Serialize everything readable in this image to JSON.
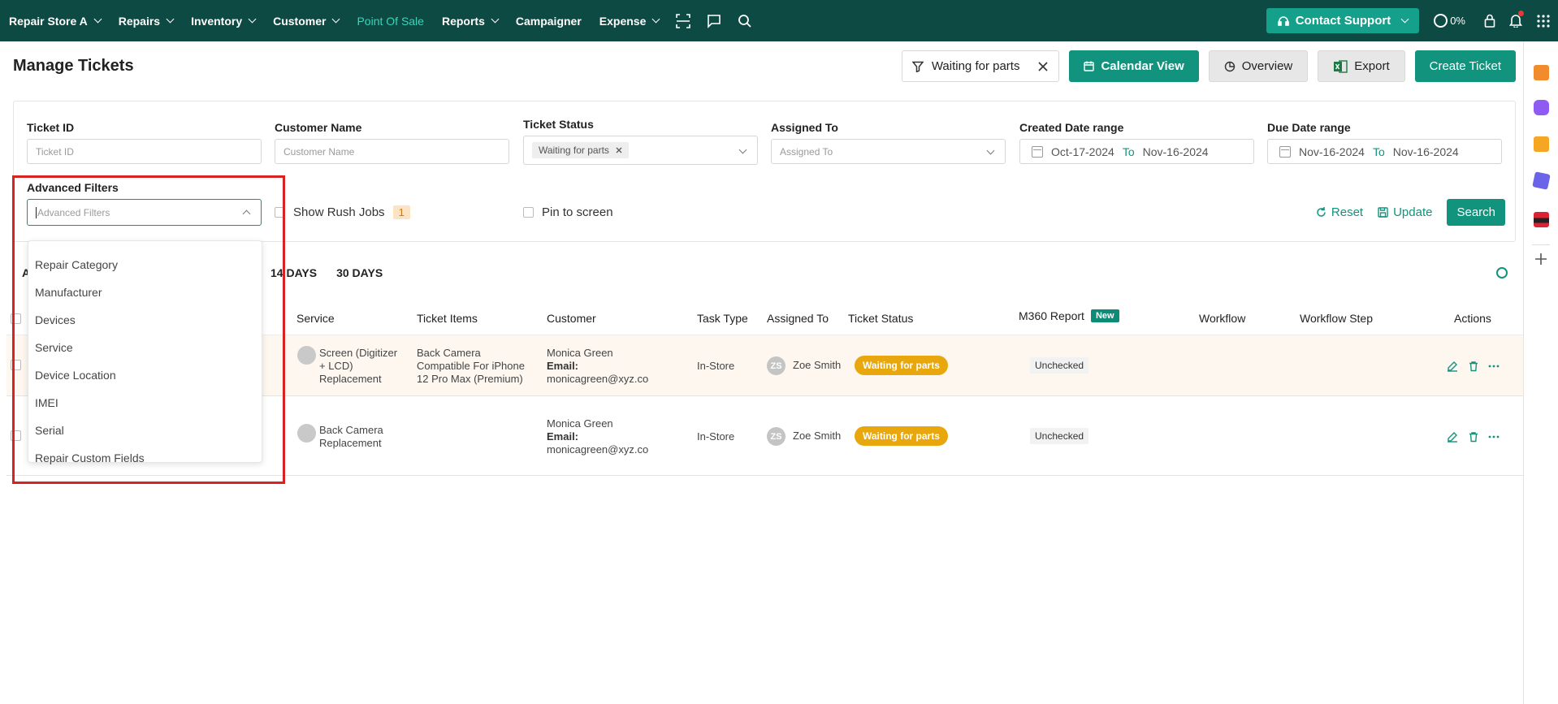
{
  "nav": {
    "store": "Repair Store A",
    "items": [
      {
        "label": "Repairs",
        "has_menu": true
      },
      {
        "label": "Inventory",
        "has_menu": true
      },
      {
        "label": "Customer",
        "has_menu": true
      },
      {
        "label": "Point Of Sale",
        "has_menu": false,
        "active": true
      },
      {
        "label": "Reports",
        "has_menu": true
      },
      {
        "label": "Campaigner",
        "has_menu": false
      },
      {
        "label": "Expense",
        "has_menu": true
      }
    ],
    "contact_support": "Contact Support",
    "progress": "0%"
  },
  "page": {
    "title": "Manage Tickets",
    "active_filter": "Waiting for parts",
    "buttons": {
      "calendar": "Calendar View",
      "overview": "Overview",
      "export": "Export",
      "create": "Create Ticket"
    }
  },
  "filters": {
    "ticket_id": {
      "label": "Ticket ID",
      "placeholder": "Ticket ID"
    },
    "customer_name": {
      "label": "Customer Name",
      "placeholder": "Customer Name"
    },
    "ticket_status": {
      "label": "Ticket Status",
      "value": "Waiting for parts"
    },
    "assigned_to": {
      "label": "Assigned To",
      "placeholder": "Assigned To"
    },
    "created_range": {
      "label": "Created Date range",
      "from": "Oct-17-2024",
      "to_label": "To",
      "to": "Nov-16-2024"
    },
    "due_range": {
      "label": "Due Date range",
      "from": "Nov-16-2024",
      "to_label": "To",
      "to": "Nov-16-2024"
    },
    "advanced": {
      "label": "Advanced Filters",
      "placeholder": "Advanced Filters"
    },
    "rush_jobs": {
      "label": "Show Rush Jobs",
      "count": "1"
    },
    "pin": {
      "label": "Pin to screen"
    },
    "reset": "Reset",
    "update": "Update",
    "search": "Search"
  },
  "dropdown": {
    "options": [
      "Repair Category",
      "Manufacturer",
      "Devices",
      "Service",
      "Device Location",
      "IMEI",
      "Serial",
      "Repair Custom Fields"
    ]
  },
  "tabs": {
    "partial": "A",
    "items": [
      "14 DAYS",
      "30 DAYS"
    ]
  },
  "table": {
    "headers": {
      "service": "Service",
      "items": "Ticket Items",
      "customer": "Customer",
      "task": "Task Type",
      "assigned": "Assigned To",
      "status": "Ticket Status",
      "m360": "M360 Report",
      "m360_badge": "New",
      "workflow": "Workflow",
      "step": "Workflow Step",
      "actions": "Actions"
    },
    "rows": [
      {
        "service": [
          "Screen (Digitizer",
          "+ LCD)",
          "Replacement"
        ],
        "items": [
          "Back Camera",
          "Compatible For iPhone",
          "12 Pro Max (Premium)"
        ],
        "customer_name": "Monica Green",
        "email_label": "Email:",
        "email": "monicagreen@xyz.co",
        "task": "In-Store",
        "assignee_initials": "ZS",
        "assignee": "Zoe Smith",
        "status": "Waiting for parts",
        "m360": "Unchecked"
      },
      {
        "service": [
          "Back Camera",
          "Replacement"
        ],
        "items": [],
        "customer_name": "Monica Green",
        "email_label": "Email:",
        "email": "monicagreen@xyz.co",
        "task": "In-Store",
        "assignee_initials": "ZS",
        "assignee": "Zoe Smith",
        "status": "Waiting for parts",
        "m360": "Unchecked"
      }
    ]
  },
  "colors": {
    "nav_bg": "#0d4a43",
    "accent": "#12937e",
    "status_pill": "#e8a70c",
    "highlight": "#d92323"
  }
}
